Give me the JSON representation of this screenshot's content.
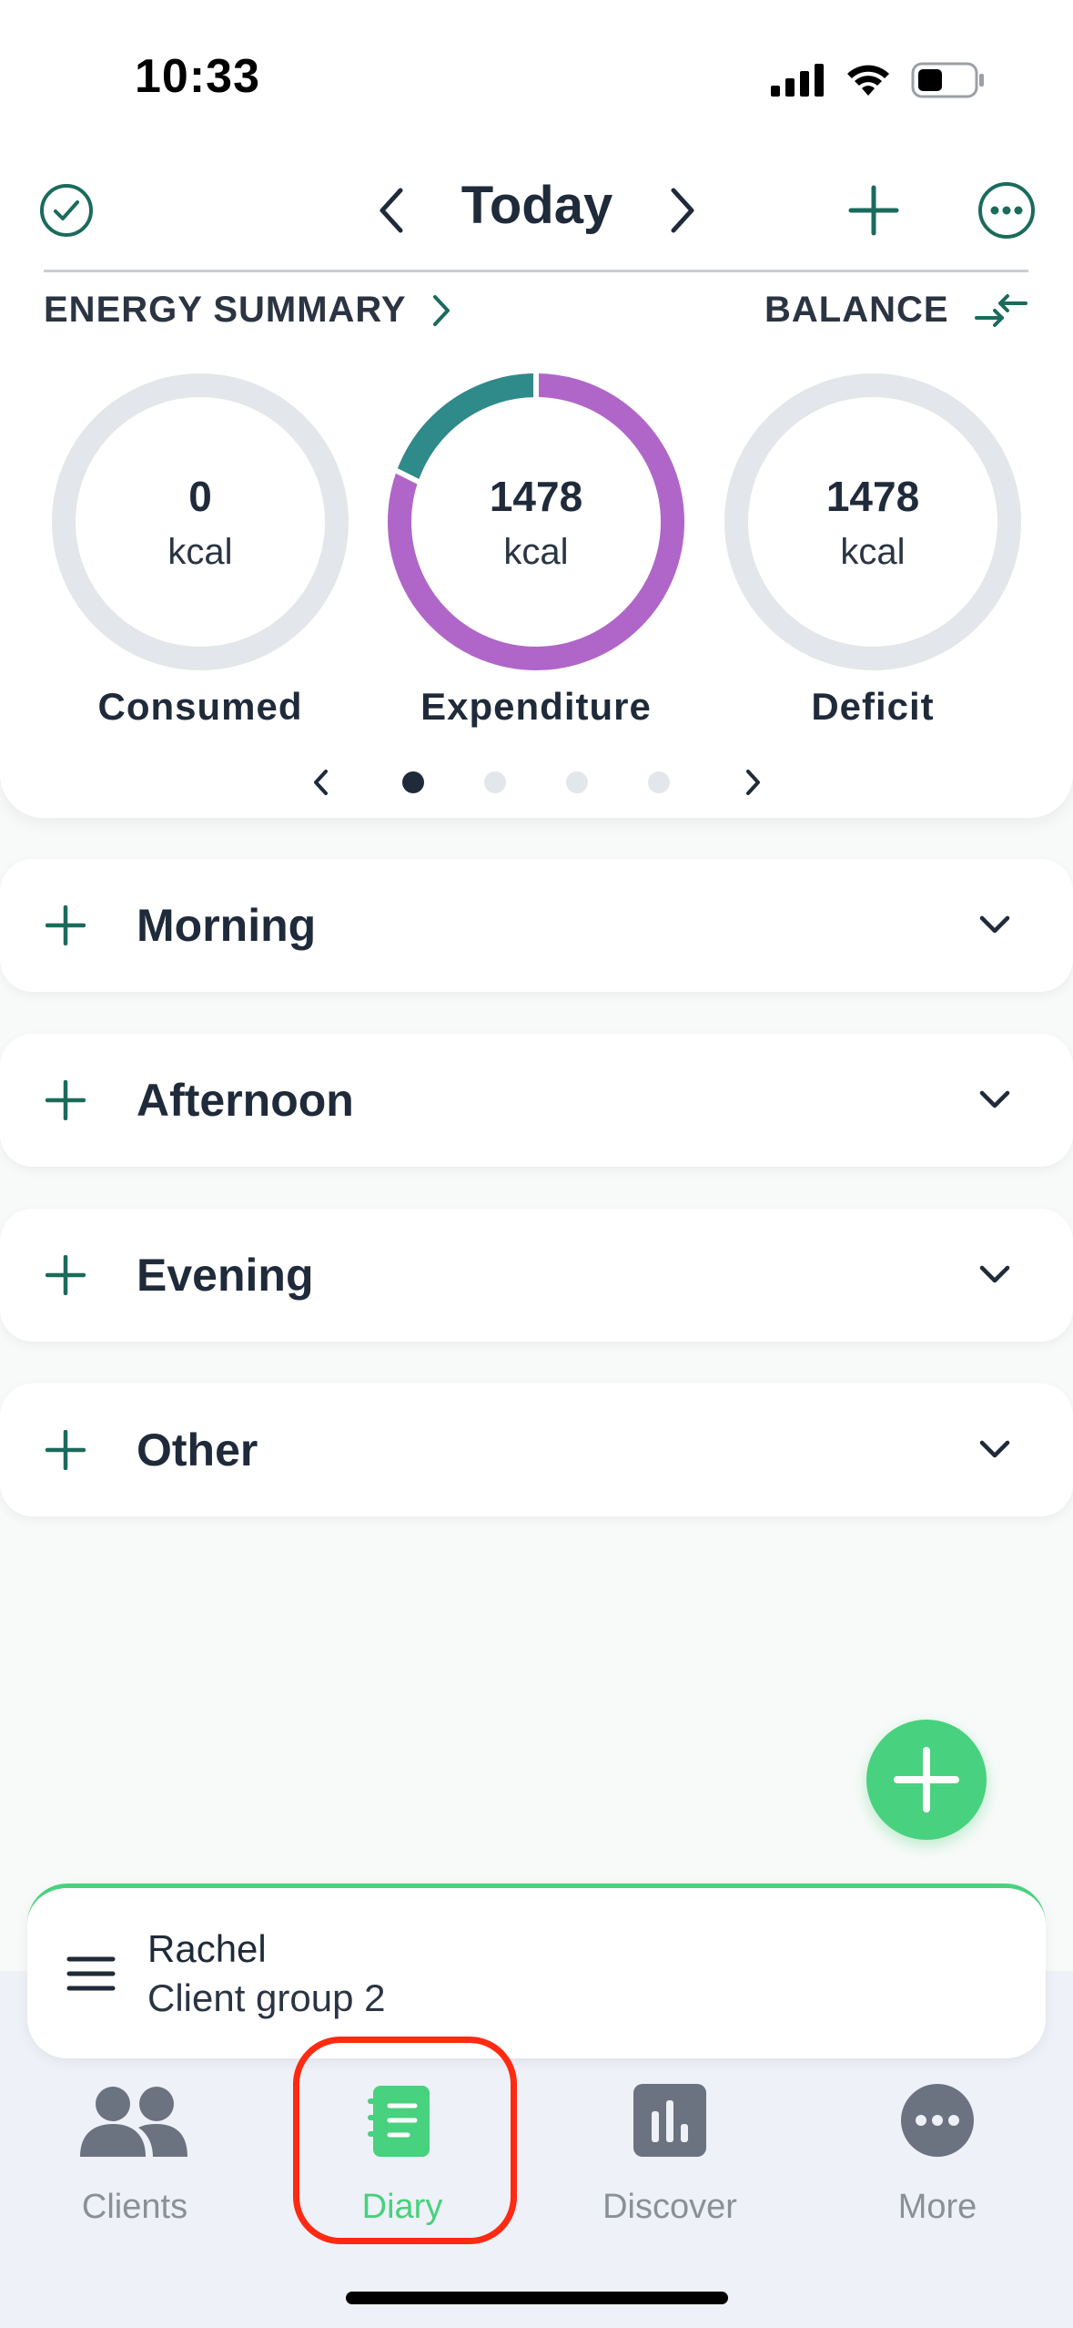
{
  "status_bar": {
    "time": "10:33"
  },
  "header": {
    "title": "Today"
  },
  "energy_summary": {
    "title": "ENERGY SUMMARY",
    "balance_label": "BALANCE",
    "rings": [
      {
        "value": "0",
        "unit": "kcal",
        "caption": "Consumed",
        "fill_fraction": 0
      },
      {
        "value": "1478",
        "unit": "kcal",
        "caption": "Expenditure",
        "fill_fraction": 1
      },
      {
        "value": "1478",
        "unit": "kcal",
        "caption": "Deficit",
        "fill_fraction": 0
      }
    ],
    "page_dots": {
      "count": 4,
      "active": 1
    }
  },
  "meals": [
    {
      "label": "Morning"
    },
    {
      "label": "Afternoon"
    },
    {
      "label": "Evening"
    },
    {
      "label": "Other"
    }
  ],
  "client": {
    "name": "Rachel",
    "group": "Client group 2"
  },
  "tabs": [
    {
      "label": "Clients",
      "icon": "people-icon",
      "active": false
    },
    {
      "label": "Diary",
      "icon": "diary-icon",
      "active": true
    },
    {
      "label": "Discover",
      "icon": "chart-icon",
      "active": false
    },
    {
      "label": "More",
      "icon": "more-icon",
      "active": false
    }
  ],
  "colors": {
    "accent_green": "#48d17e",
    "teal": "#1b6b5c",
    "purple": "#b066c8",
    "ring_teal": "#2e8b8a",
    "ring_empty": "#e3e6ea",
    "highlight_red": "#ff2a12"
  }
}
